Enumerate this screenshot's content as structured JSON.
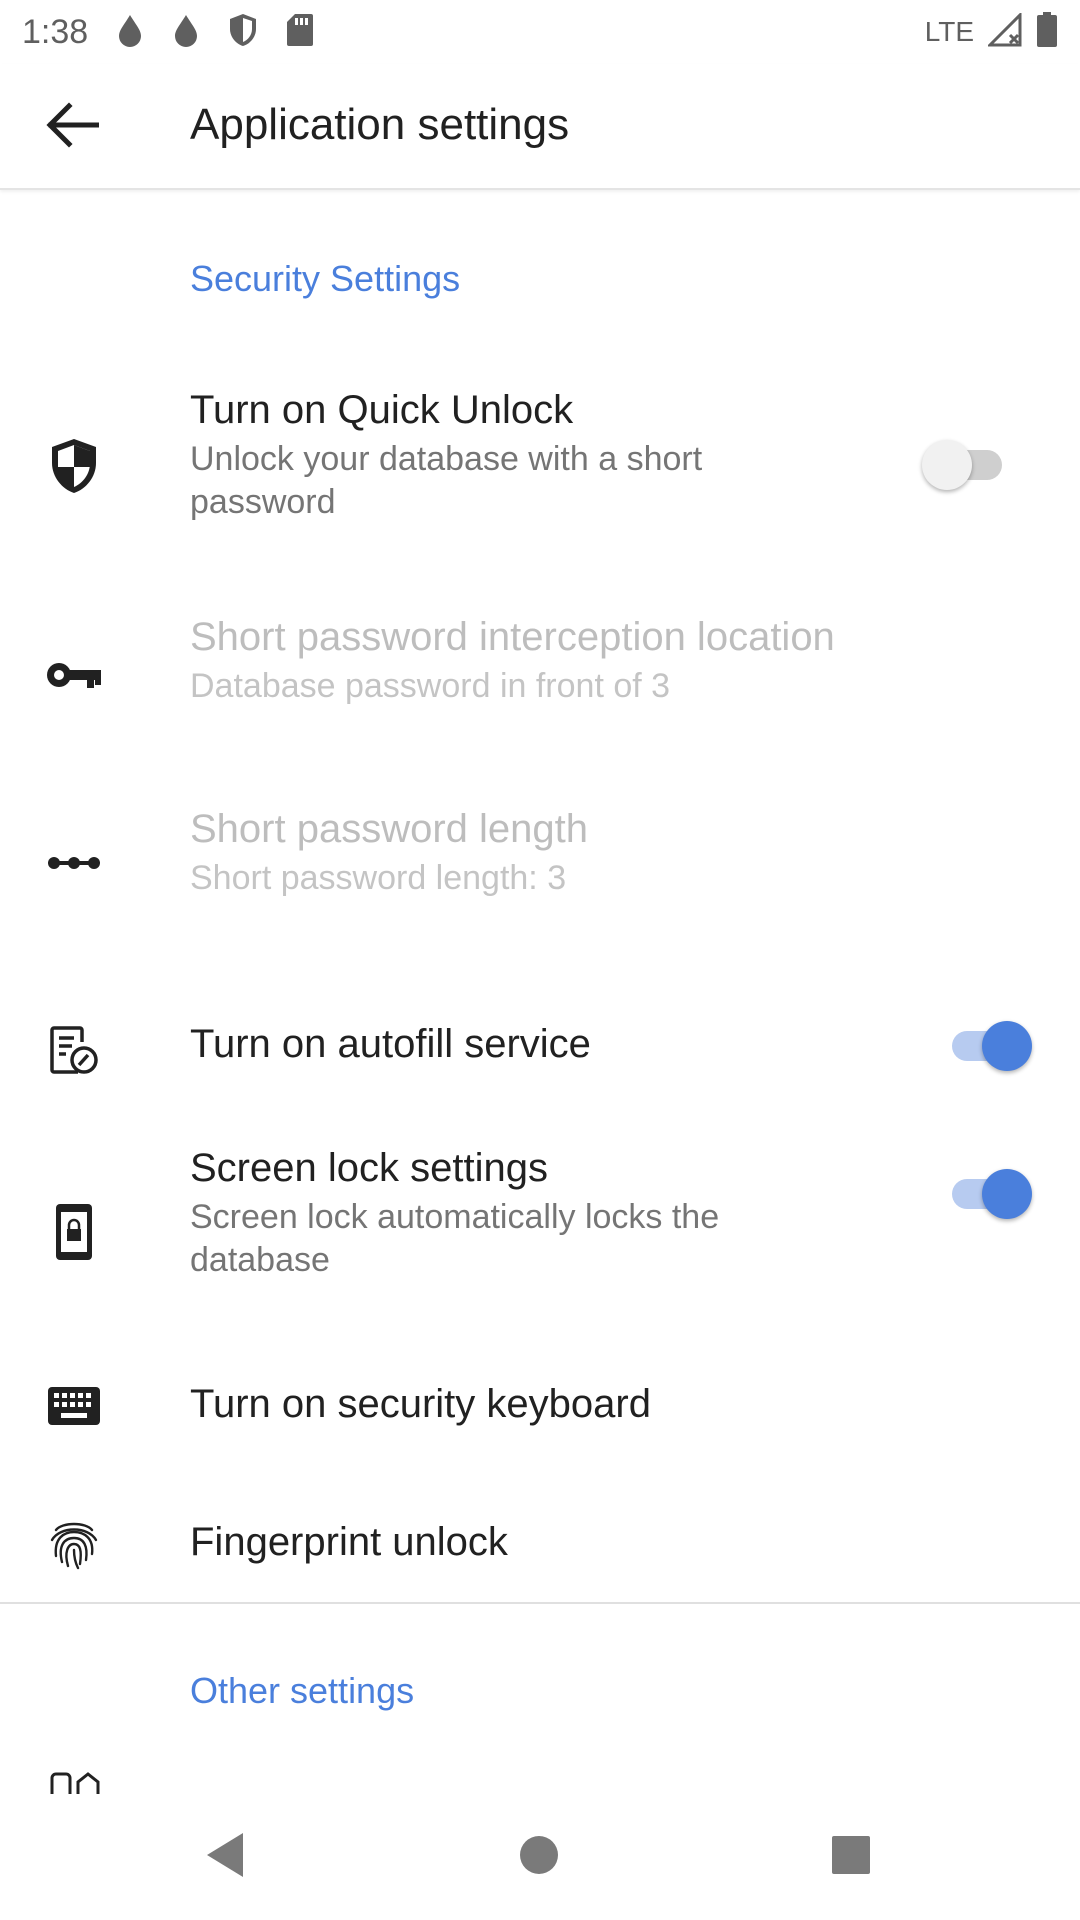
{
  "status_bar": {
    "time": "1:38",
    "network": "LTE",
    "icons": [
      "drop-icon",
      "drop-icon",
      "shield-icon",
      "sd-card-icon",
      "signal-icon",
      "battery-icon"
    ]
  },
  "app_bar": {
    "title": "Application settings",
    "back_icon": "arrow-left-icon"
  },
  "sections": [
    {
      "header": "Security Settings",
      "items": [
        {
          "icon": "shield-icon",
          "title": "Turn on Quick Unlock",
          "summary": "Unlock your database with a short password",
          "switch": false,
          "enabled": true
        },
        {
          "icon": "key-icon",
          "title": "Short password interception location",
          "summary": "Database password in front of 3",
          "enabled": false
        },
        {
          "icon": "dots-icon",
          "title": "Short password length",
          "summary": "Short password length: 3",
          "enabled": false
        },
        {
          "icon": "autofill-icon",
          "title": "Turn on autofill service",
          "switch": true,
          "enabled": true
        },
        {
          "icon": "lock-phone-icon",
          "title": "Screen lock settings",
          "summary": "Screen lock automatically locks the database",
          "switch": true,
          "enabled": true
        },
        {
          "icon": "keyboard-icon",
          "title": "Turn on security keyboard",
          "enabled": true
        },
        {
          "icon": "fingerprint-icon",
          "title": "Fingerprint unlock",
          "enabled": true
        }
      ]
    },
    {
      "header": "Other settings",
      "items": []
    }
  ],
  "colors": {
    "accent": "#4a7fdc",
    "title_text": "#212121",
    "summary_text": "#757575",
    "disabled_text": "#bdbdbd"
  },
  "nav_bar": {
    "buttons": [
      "back-triangle-icon",
      "home-circle-icon",
      "recents-square-icon"
    ]
  }
}
